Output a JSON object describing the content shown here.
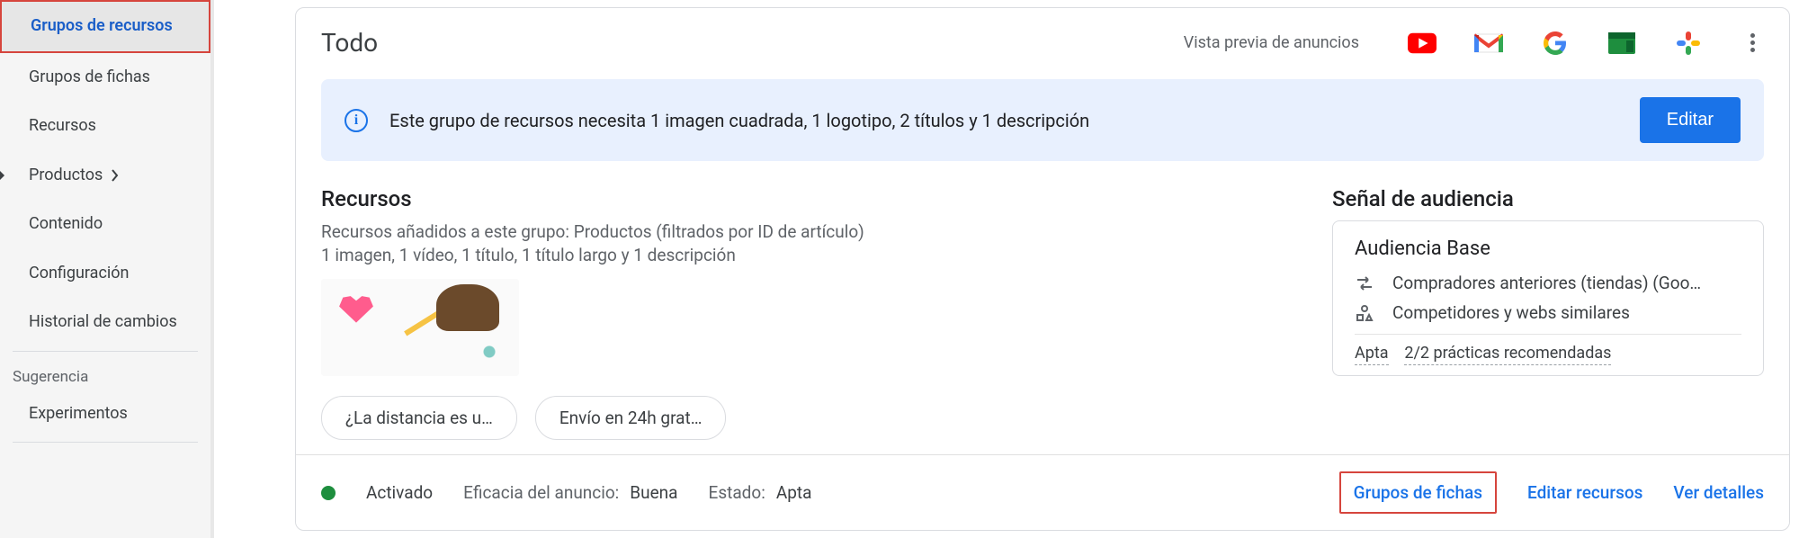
{
  "sidebar": {
    "items": [
      {
        "label": "Grupos de recursos"
      },
      {
        "label": "Grupos de fichas"
      },
      {
        "label": "Recursos"
      },
      {
        "label": "Productos"
      },
      {
        "label": "Contenido"
      },
      {
        "label": "Configuración"
      },
      {
        "label": "Historial de cambios"
      }
    ],
    "section_label": "Sugerencia",
    "items2": [
      {
        "label": "Experimentos"
      }
    ]
  },
  "header": {
    "title": "Todo",
    "preview_label": "Vista previa de anuncios"
  },
  "notice": {
    "message": "Este grupo de recursos necesita 1 imagen cuadrada, 1 logotipo, 2 títulos y 1 descripción",
    "button": "Editar"
  },
  "resources": {
    "heading": "Recursos",
    "line1": "Recursos añadidos a este grupo: Productos (filtrados por ID de artículo)",
    "line2": "1 imagen, 1 vídeo, 1 título, 1 título largo y 1 descripción",
    "chips": [
      "¿La distancia es u…",
      "Envío en 24h grat…"
    ]
  },
  "audience": {
    "heading": "Señal de audiencia",
    "box_title": "Audiencia Base",
    "rows": [
      "Compradores anteriores (tiendas) (Goo…",
      "Competidores y webs similares"
    ],
    "apta_label": "Apta",
    "practices": "2/2 prácticas recomendadas"
  },
  "footer": {
    "status": "Activado",
    "eff_label": "Eficacia del anuncio:",
    "eff_value": "Buena",
    "state_label": "Estado:",
    "state_value": "Apta",
    "links": [
      "Grupos de fichas",
      "Editar recursos",
      "Ver detalles"
    ]
  }
}
